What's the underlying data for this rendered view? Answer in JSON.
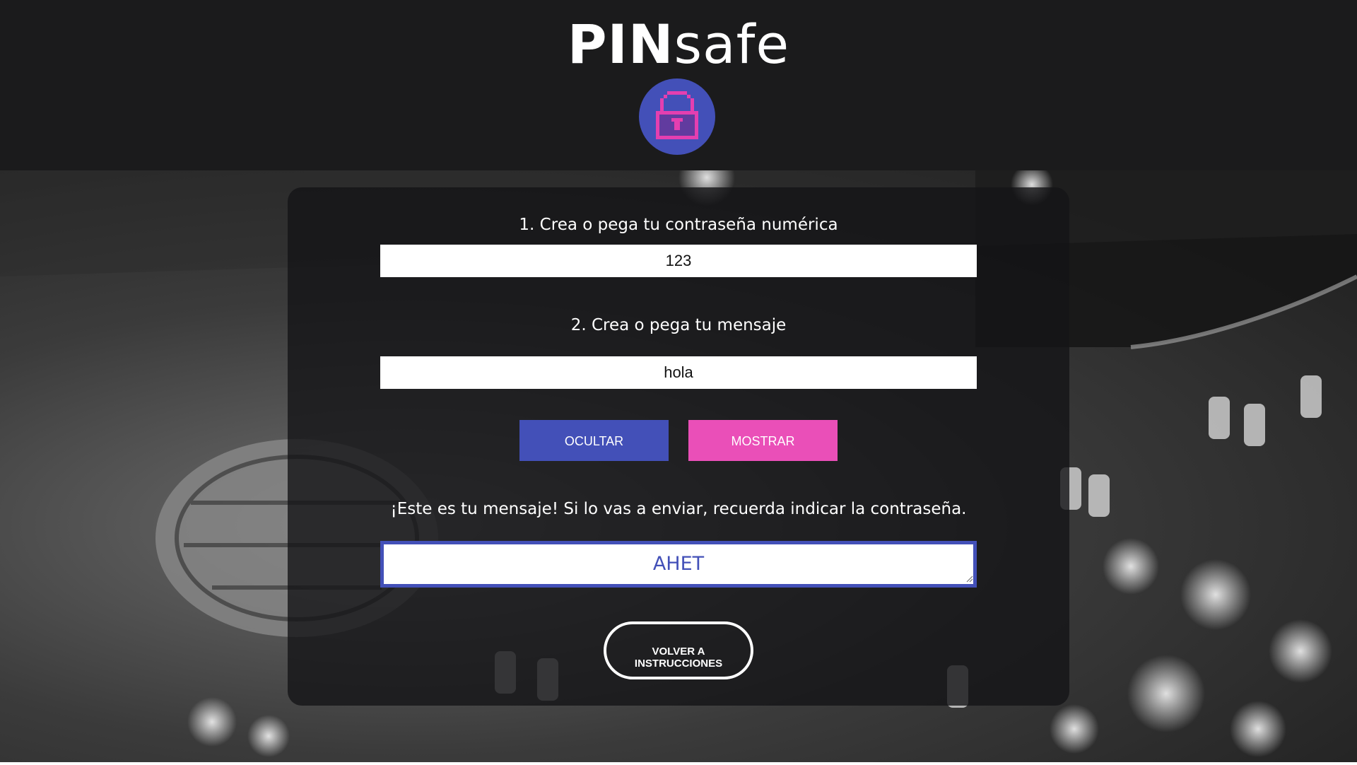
{
  "header": {
    "title_bold": "PIN",
    "title_light": "safe",
    "logo_icon": "padlock-icon"
  },
  "form": {
    "password_label": "1. Crea o pega tu contraseña numérica",
    "password_value": "123",
    "message_label": "2. Crea o pega tu mensaje",
    "message_value": "hola"
  },
  "buttons": {
    "hide_label": "OCULTAR",
    "show_label": "MOSTRAR"
  },
  "result": {
    "note": "¡Este es tu mensaje! Si lo vas a enviar, recuerda indicar la contraseña.",
    "value": "AHET"
  },
  "back_button": {
    "label_line1": "VOLVER A",
    "label_line2": "INSTRUCCIONES"
  },
  "colors": {
    "header_bg": "#1b1b1c",
    "primary_blue": "#4350b8",
    "accent_pink": "#ea4fb8",
    "card_bg": "rgba(20,20,22,0.8)"
  }
}
